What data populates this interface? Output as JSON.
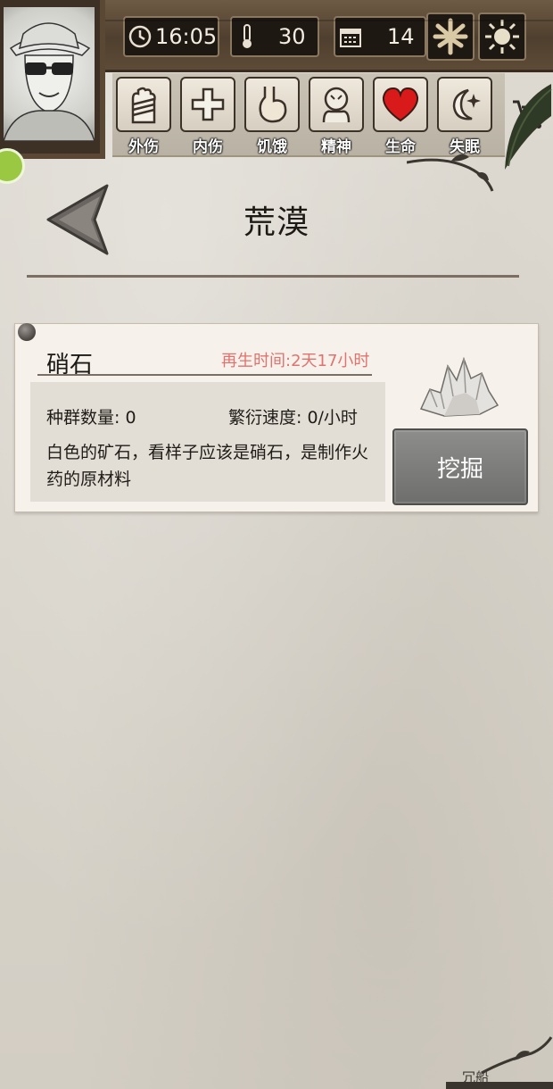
{
  "hud": {
    "time": "16:05",
    "temperature": "30",
    "day": "14",
    "season_icon": "leaf-icon",
    "weather_icon": "sun-icon"
  },
  "status_icons": [
    {
      "label": "外伤",
      "icon": "bandaged-hand-icon"
    },
    {
      "label": "内伤",
      "icon": "cross-icon"
    },
    {
      "label": "饥饿",
      "icon": "stomach-icon"
    },
    {
      "label": "精神",
      "icon": "head-icon"
    },
    {
      "label": "生命",
      "icon": "heart-icon"
    },
    {
      "label": "失眠",
      "icon": "moon-icon"
    }
  ],
  "page": {
    "title": "荒漠"
  },
  "resource": {
    "name": "硝石",
    "regen": "再生时间:2天17小时",
    "population": "种群数量: 0",
    "rate": "繁衍速度: 0/小时",
    "description": "白色的矿石，看样子应该是硝石，是制作火药的原材料",
    "action": "挖掘"
  },
  "bottom": {
    "tab_label": "冗船"
  },
  "colors": {
    "paper": "#dedad2",
    "wood": "#5d4b37",
    "regen_text": "#e0736f",
    "button": "#7d7d7b",
    "heart": "#d81a1a"
  }
}
